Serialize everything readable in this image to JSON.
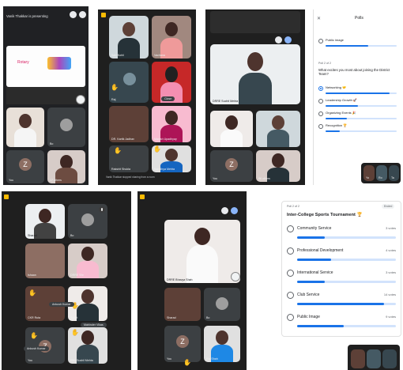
{
  "panel1": {
    "presenting_label": "Vanik Thakkar is presenting",
    "slide_logo": "Rotary",
    "tiles": [
      {
        "name": "",
        "kind": "person"
      },
      {
        "name": "Bo",
        "kind": "person"
      },
      {
        "name": "You",
        "avatar": "Z"
      },
      {
        "name": "17 others",
        "kind": "person"
      }
    ]
  },
  "panel2": {
    "tiles": [
      "Salil Kohli",
      "Vachana",
      "Bijal",
      "Raj",
      "DR. Kartik Jadhav",
      "Manish Upadhyay",
      "Rakshit Shukla",
      "Sanidhya Mehta"
    ],
    "hands_label": "Vanik",
    "stopped_sharing": "Vanik Thakkar stopped sharing from a room",
    "chip": "Close"
  },
  "panel3": {
    "main_name": "DRRE Suchit Mehta",
    "tiles": [
      "",
      "",
      "You",
      "86 others"
    ],
    "avatar": "Z"
  },
  "polls_small": {
    "title": "Polls",
    "top_option": "Public image",
    "poll_count": "Poll 2 of 2",
    "question": "What excites you most about joining the District Team?",
    "options": [
      {
        "label": "Networking 🤝",
        "fill": 0.9,
        "selected": true
      },
      {
        "label": "Leadership Growth 🚀",
        "fill": 0.45,
        "selected": false
      },
      {
        "label": "Organizing Events 🎉",
        "fill": 0.3,
        "selected": false
      },
      {
        "label": "Recognition 🏆",
        "fill": 0.2,
        "selected": false
      }
    ],
    "mini_tiles": [
      "Yo",
      "Ro",
      "Ta"
    ]
  },
  "panel4": {
    "tiles": [
      "Sharad",
      "Bo",
      "Ishaan",
      "DRRE Shr",
      "CKR Ruta",
      "Sumit",
      "Ankush Kumar",
      "Vishal Sumtheti",
      "You",
      "Ritik Sushil Mehta"
    ],
    "hand_labels": [
      "Ankush Kumar",
      "Mahinder Vikas",
      "Ankush Kumar"
    ],
    "avatar": "Z"
  },
  "panel5": {
    "main_name": "DRRE Bhavya Shah",
    "tiles": [
      "Sharad",
      "Bo",
      "You",
      "Raj Shah"
    ],
    "avatar": "Z"
  },
  "polls_large": {
    "poll_count": "Poll 2 of 2",
    "badge": "Ended",
    "title": "Inter-College Sports Tournament 🏆",
    "options": [
      {
        "label": "Community Service",
        "votes": "3 votes",
        "fill": 0.28
      },
      {
        "label": "Professional Development",
        "votes": "4 votes",
        "fill": 0.34
      },
      {
        "label": "International Service",
        "votes": "3 votes",
        "fill": 0.28
      },
      {
        "label": "Club Service",
        "votes": "14 votes",
        "fill": 0.88
      },
      {
        "label": "Public Image",
        "votes": "9 votes",
        "fill": 0.47
      }
    ]
  }
}
